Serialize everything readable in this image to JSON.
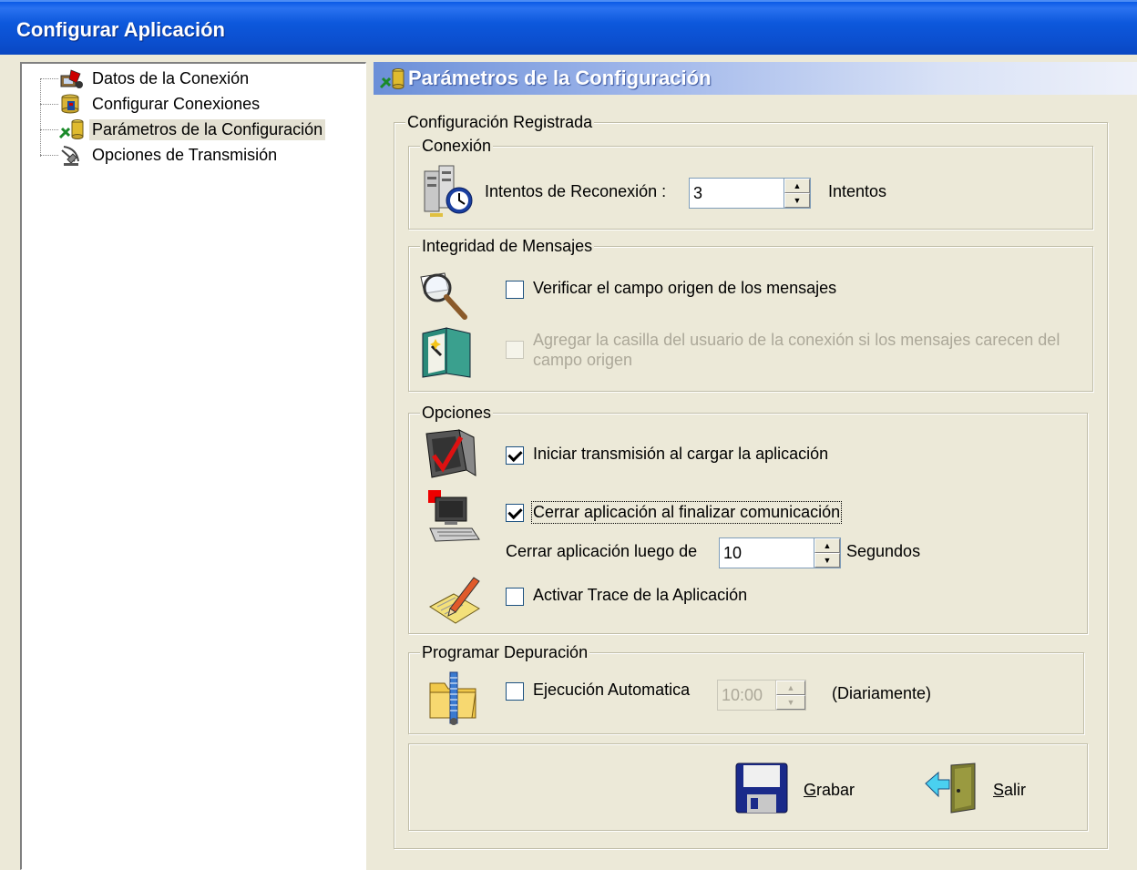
{
  "window": {
    "title": "Configurar Aplicación"
  },
  "tree": {
    "items": [
      {
        "label": "Datos de la Conexión",
        "icon": "connection-data-icon"
      },
      {
        "label": "Configurar Conexiones",
        "icon": "configure-connections-icon"
      },
      {
        "label": "Parámetros de la Configuración",
        "icon": "config-parameters-icon",
        "selected": true
      },
      {
        "label": "Opciones de Transmisión",
        "icon": "satellite-transmission-icon"
      }
    ]
  },
  "panel": {
    "title": "Parámetros de la Configuración"
  },
  "config": {
    "legend": "Configuración Registrada",
    "conexion": {
      "legend": "Conexión",
      "reconnect_label": "Intentos de Reconexión :",
      "reconnect_value": "3",
      "reconnect_unit": "Intentos"
    },
    "integridad": {
      "legend": "Integridad de Mensajes",
      "verify_label": "Verificar el campo origen de los mensajes",
      "verify_checked": false,
      "add_user_label": "Agregar la casilla del usuario de la conexión si los mensajes carecen del campo origen",
      "add_user_checked": false,
      "add_user_enabled": false
    },
    "opciones": {
      "legend": "Opciones",
      "start_label": "Iniciar transmisión al cargar la aplicación",
      "start_checked": true,
      "close_label": "Cerrar aplicación al finalizar comunicación",
      "close_checked": true,
      "close_after_label": "Cerrar aplicación luego de",
      "close_after_value": "10",
      "close_after_unit": "Segundos",
      "trace_label": "Activar Trace de la Aplicación",
      "trace_checked": false
    },
    "depuracion": {
      "legend": "Programar Depuración",
      "auto_label": "Ejecución Automatica",
      "auto_checked": false,
      "time_value": "10:00",
      "time_suffix": "(Diariamente)"
    }
  },
  "actions": {
    "save_prefix": "G",
    "save_rest": "rabar",
    "exit_prefix": "S",
    "exit_rest": "alir"
  },
  "colors": {
    "titlebar": "#0b4fcf",
    "panel_header": "#6b8fd8",
    "window_bg": "#ece9d8"
  }
}
